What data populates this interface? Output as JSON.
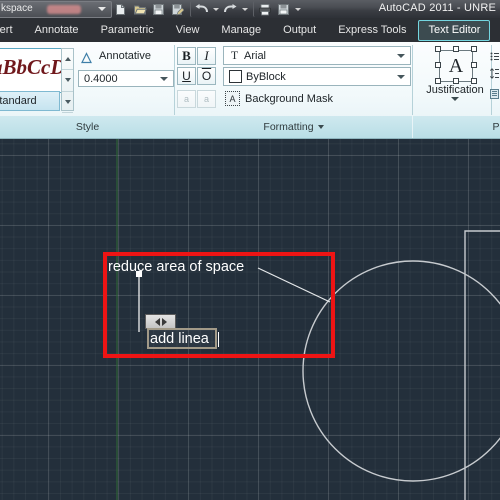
{
  "titlebar": {
    "workspace_value": "kspace",
    "app_title": "AutoCAD 2011 - UNRE",
    "quick_access": [
      {
        "name": "new-icon",
        "glyph": "❐"
      },
      {
        "name": "open-icon",
        "glyph": "▶"
      },
      {
        "name": "save-icon",
        "glyph": "▣"
      },
      {
        "name": "save-as-icon",
        "glyph": "▤"
      },
      {
        "name": "undo-icon",
        "glyph": "↶"
      },
      {
        "name": "redo-icon",
        "glyph": "↷"
      },
      {
        "name": "plot-icon",
        "glyph": "⎙"
      },
      {
        "name": "sheetset-icon",
        "glyph": "▦"
      }
    ]
  },
  "ribbon": {
    "tabs": [
      {
        "label": "Insert",
        "active": false
      },
      {
        "label": "Annotate",
        "active": false
      },
      {
        "label": "Parametric",
        "active": false
      },
      {
        "label": "View",
        "active": false
      },
      {
        "label": "Manage",
        "active": false
      },
      {
        "label": "Output",
        "active": false
      },
      {
        "label": "Express Tools",
        "active": false
      },
      {
        "label": "Text Editor",
        "active": true
      }
    ],
    "style_panel": {
      "title": "Style",
      "preview_text": "aBbCcD",
      "style_name": "Standard",
      "annotative_label": "Annotative",
      "text_height": "0.4000"
    },
    "formatting_panel": {
      "title": "Formatting",
      "bold": "B",
      "italic": "I",
      "underline": "U",
      "overline": "O",
      "superscript": "a",
      "subscript": "a",
      "font_name": "Arial",
      "color_name": "ByBlock",
      "background_mask": "Background Mask"
    },
    "justification_panel": {
      "title": "Justification",
      "icon_letter": "A"
    },
    "paragraph_panel": {
      "title": "P"
    }
  },
  "canvas": {
    "annotation_text": "reduce area of space",
    "editor_text": "add linea",
    "colors": {
      "background": "#232f3b",
      "highlight_box": "#ee1414",
      "geometry": "#c7cbcf",
      "axis_green": "#2f6b35"
    }
  }
}
